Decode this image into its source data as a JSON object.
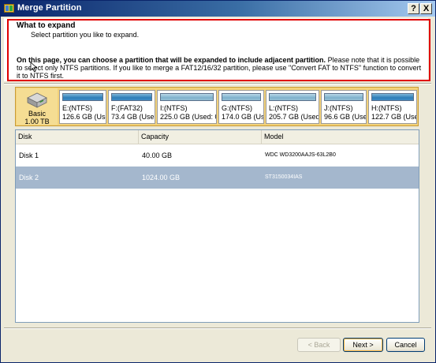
{
  "window": {
    "title": "Merge Partition",
    "help_button": "?",
    "close_button": "X"
  },
  "header": {
    "title": "What to expand",
    "subtitle": "Select partition you like to expand.",
    "description_bold": "On this page, you can choose a partition that will be expanded to include adjacent partition.",
    "description_rest": " Please note that it is possible to select only NTFS partitions. If you like to merge a FAT12/16/32 partition, please use \"Convert FAT to NTFS\" function to convert it to NTFS first.",
    "highlight_color": "#e00000"
  },
  "disk_map": {
    "disk_type": "Basic",
    "disk_size": "1.00 TB",
    "partitions": [
      {
        "name": "E:(NTFS)",
        "size": "126.6 GB (Use"
      },
      {
        "name": "F:(FAT32)",
        "size": "73.4 GB (Use"
      },
      {
        "name": "I:(NTFS)",
        "size": "225.0 GB (Used: 0"
      },
      {
        "name": "G:(NTFS)",
        "size": "174.0 GB (Use"
      },
      {
        "name": "L:(NTFS)",
        "size": "205.7 GB (Used"
      },
      {
        "name": "J:(NTFS)",
        "size": "96.6 GB (Use"
      },
      {
        "name": "H:(NTFS)",
        "size": "122.7 GB (Use"
      }
    ]
  },
  "disk_table": {
    "columns": [
      "Disk",
      "Capacity",
      "Model"
    ],
    "rows": [
      {
        "disk": "Disk 1",
        "capacity": "40.00 GB",
        "model": "WDC WD3200AAJS-63L2B0",
        "selected": false
      },
      {
        "disk": "Disk 2",
        "capacity": "1024.00 GB",
        "model": "ST3150034IAS",
        "selected": true
      }
    ]
  },
  "buttons": {
    "back": "< Back",
    "next": "Next >",
    "cancel": "Cancel"
  }
}
